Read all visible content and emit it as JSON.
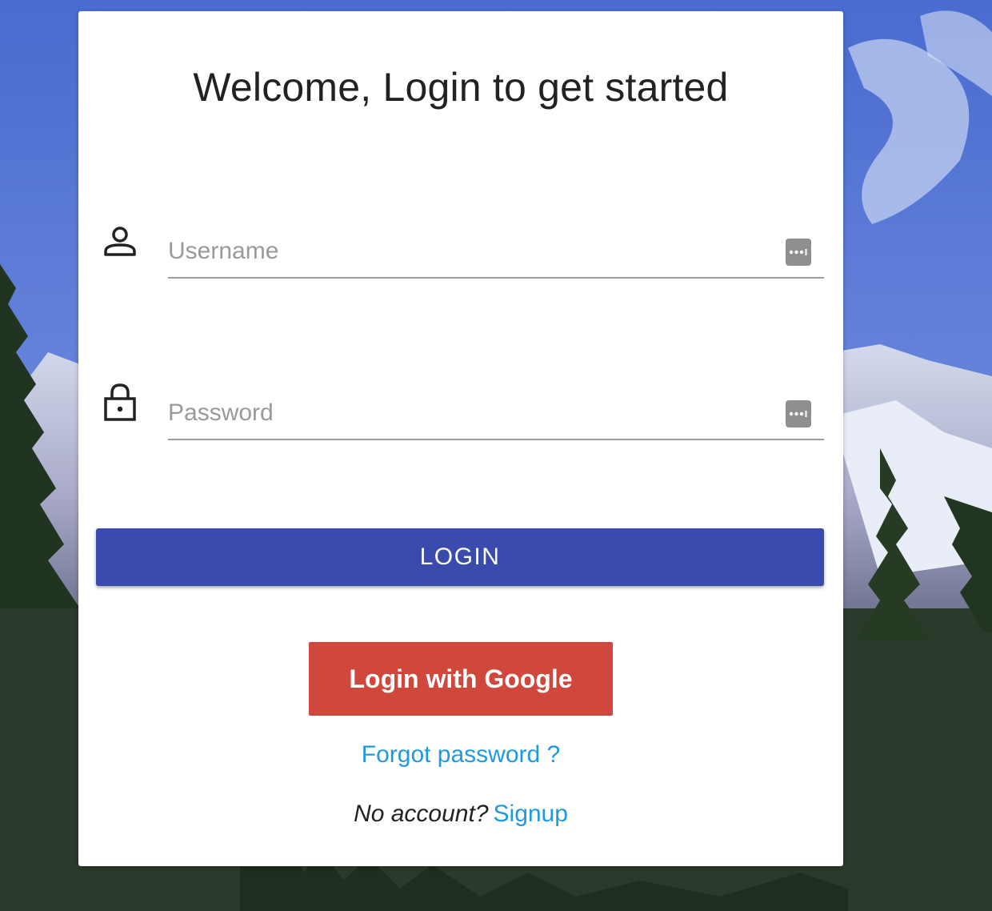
{
  "page": {
    "title": "Welcome, Login to get started"
  },
  "form": {
    "username": {
      "placeholder": "Username",
      "value": ""
    },
    "password": {
      "placeholder": "Password",
      "value": ""
    },
    "login_label": "LOGIN",
    "google_label": "Login with Google",
    "forgot_label": "Forgot password ?",
    "no_account_label": "No account?",
    "signup_label": "Signup"
  },
  "icons": {
    "username": "person-icon",
    "password": "lock-icon",
    "password_manager": "password-manager-icon"
  },
  "colors": {
    "primary_button": "#3b4aad",
    "google_button": "#d0483c",
    "link": "#1e9ae0"
  }
}
